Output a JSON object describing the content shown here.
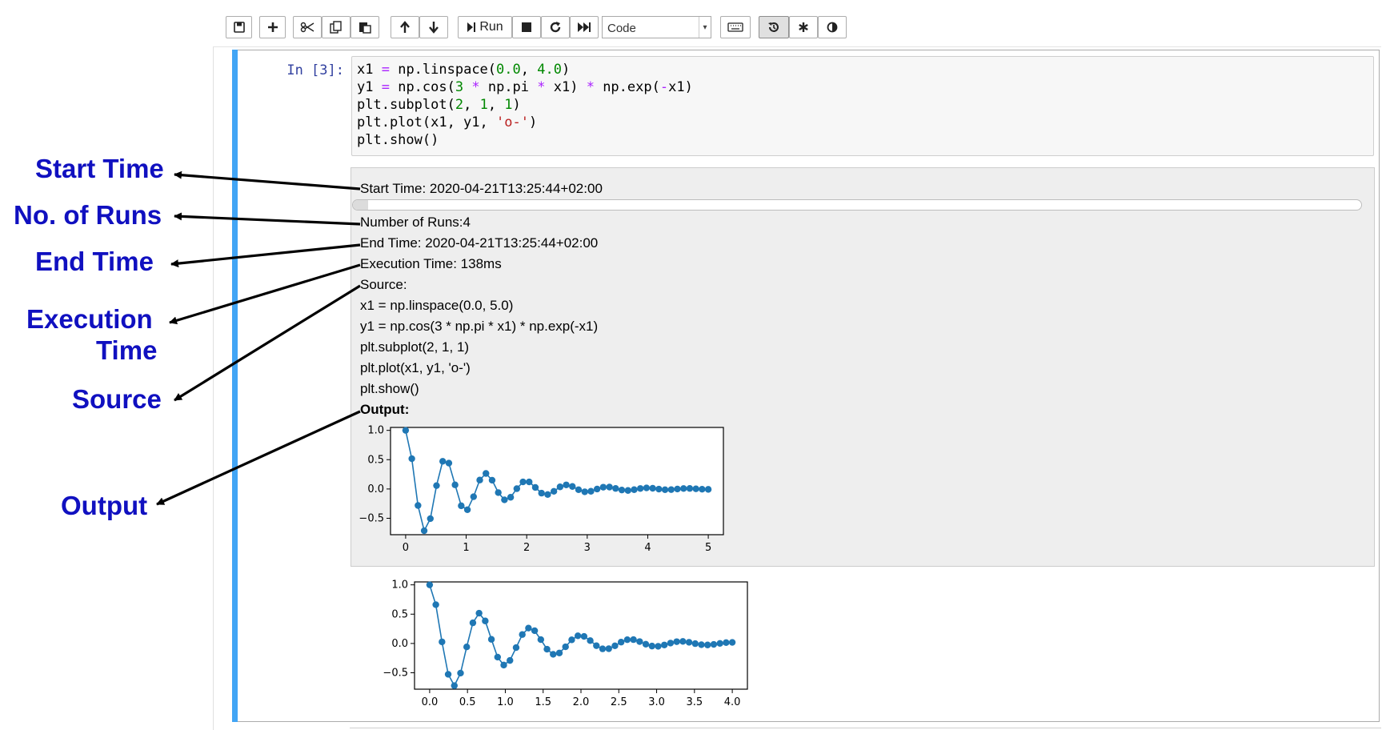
{
  "toolbar": {
    "run_label": "Run",
    "cell_type": "Code"
  },
  "cell": {
    "prompt": "In [3]:",
    "code": [
      "x1 = np.linspace(0.0, 4.0)",
      "y1 = np.cos(3 * np.pi * x1) * np.exp(-x1)",
      "plt.subplot(2, 1, 1)",
      "plt.plot(x1, y1, 'o-')",
      "plt.show()"
    ]
  },
  "output_widget": {
    "start_time": "Start Time: 2020-04-21T13:25:44+02:00",
    "progress": 0.015,
    "num_runs": "Number of Runs:4",
    "end_time": "End Time: 2020-04-21T13:25:44+02:00",
    "execution_time": "Execution Time: 138ms",
    "source_label": "Source:",
    "source_lines": [
      "x1 = np.linspace(0.0, 5.0)",
      "y1 = np.cos(3 * np.pi * x1) * np.exp(-x1)",
      "plt.subplot(2, 1, 1)",
      "plt.plot(x1, y1, 'o-')",
      "plt.show()"
    ],
    "output_label": "Output:"
  },
  "annotations": {
    "start_time": "Start Time",
    "num_runs": "No. of Runs",
    "end_time": "End Time",
    "execution_time_1": "Execution",
    "execution_time_2": "Time",
    "source": "Source",
    "output": "Output"
  },
  "colors": {
    "cell_selected_bar": "#42a5f5",
    "annotation_text": "#1010c0",
    "plot_series": "#1f77b4"
  },
  "chart_data": [
    {
      "type": "line",
      "marker": "o",
      "function": "y = cos(3*pi*x) * exp(-x)",
      "x_start": 0.0,
      "x_end": 5.0,
      "num_points": 50,
      "xlim": [
        -0.25,
        5.25
      ],
      "ylim": [
        -0.78,
        1.05
      ],
      "x_ticks": [
        "0",
        "1",
        "2",
        "3",
        "4",
        "5"
      ],
      "y_ticks": [
        "1.0",
        "0.5",
        "0.0",
        "−0.5"
      ],
      "x_tick_values": [
        0,
        1,
        2,
        3,
        4,
        5
      ],
      "y_tick_values": [
        1.0,
        0.5,
        0.0,
        -0.5
      ]
    },
    {
      "type": "line",
      "marker": "o",
      "function": "y = cos(3*pi*x) * exp(-x)",
      "x_start": 0.0,
      "x_end": 4.0,
      "num_points": 50,
      "xlim": [
        -0.2,
        4.2
      ],
      "ylim": [
        -0.78,
        1.05
      ],
      "x_ticks": [
        "0.0",
        "0.5",
        "1.0",
        "1.5",
        "2.0",
        "2.5",
        "3.0",
        "3.5",
        "4.0"
      ],
      "y_ticks": [
        "1.0",
        "0.5",
        "0.0",
        "−0.5"
      ],
      "x_tick_values": [
        0,
        0.5,
        1,
        1.5,
        2,
        2.5,
        3,
        3.5,
        4
      ],
      "y_tick_values": [
        1.0,
        0.5,
        0.0,
        -0.5
      ]
    }
  ]
}
